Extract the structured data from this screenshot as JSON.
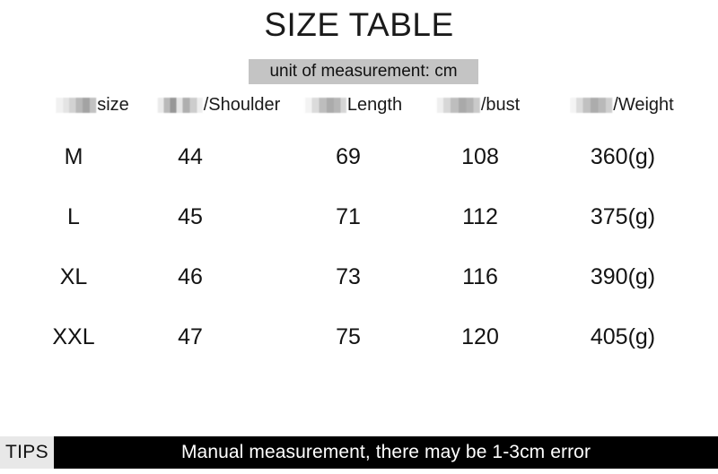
{
  "page": {
    "title": "SIZE TABLE",
    "unit_note": "unit of measurement: cm"
  },
  "table": {
    "headers": [
      {
        "redacted_prefix": "redacted-cjk-text",
        "label": "size",
        "separator": ""
      },
      {
        "redacted_prefix": "redacted-cjk-text",
        "label": "Shoulder",
        "separator": "/"
      },
      {
        "redacted_prefix": "redacted-cjk-text",
        "label": "Length",
        "separator": ""
      },
      {
        "redacted_prefix": "redacted-cjk-text",
        "label": "bust",
        "separator": "/"
      },
      {
        "redacted_prefix": "redacted-cjk-text",
        "label": "Weight",
        "separator": "/"
      }
    ],
    "rows": [
      {
        "size": "M",
        "shoulder": "44",
        "length": "69",
        "bust": "108",
        "weight": "360(g)"
      },
      {
        "size": "L",
        "shoulder": "45",
        "length": "71",
        "bust": "112",
        "weight": "375(g)"
      },
      {
        "size": "XL",
        "shoulder": "46",
        "length": "73",
        "bust": "116",
        "weight": "390(g)"
      },
      {
        "size": "XXL",
        "shoulder": "47",
        "length": "75",
        "bust": "120",
        "weight": "405(g)"
      }
    ]
  },
  "tips": {
    "label": "TIPS",
    "message": "Manual measurement, there may be 1-3cm error"
  },
  "colors": {
    "background": "#ffffff",
    "text": "#111111",
    "unit_banner_bg": "#c4c4c4",
    "tips_label_bg": "#e8e8e8",
    "tips_bar_bg": "#000000",
    "tips_bar_text": "#ffffff"
  }
}
